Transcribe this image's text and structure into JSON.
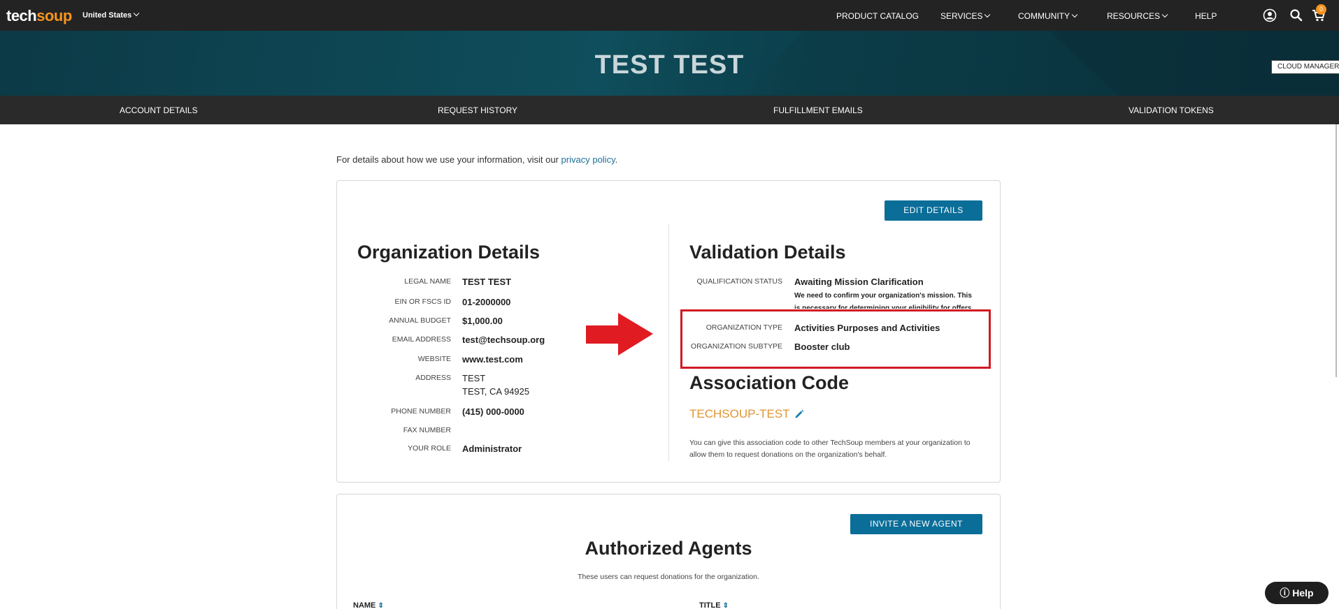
{
  "header": {
    "logo_part1": "tech",
    "logo_part2": "soup",
    "country": "United States",
    "nav": [
      "PRODUCT CATALOG",
      "SERVICES",
      "COMMUNITY",
      "RESOURCES",
      "HELP"
    ],
    "cart_count": "0",
    "icons": [
      "user-icon",
      "search-icon",
      "cart-icon"
    ]
  },
  "hero": {
    "title": "TEST TEST",
    "cloud_manager": "CLOUD MANAGER"
  },
  "subnav": [
    "ACCOUNT DETAILS",
    "REQUEST HISTORY",
    "FULFILLMENT EMAILS",
    "VALIDATION TOKENS"
  ],
  "privacy": {
    "text": "For details about how we use your information, visit our ",
    "link": "privacy policy",
    "end": "."
  },
  "org": {
    "edit_button": "EDIT DETAILS",
    "title": "Organization Details",
    "fields": [
      {
        "label": "LEGAL NAME",
        "value": "TEST TEST"
      },
      {
        "label": "EIN OR FSCS ID",
        "value": "01-2000000"
      },
      {
        "label": "ANNUAL BUDGET",
        "value": "$1,000.00"
      },
      {
        "label": "EMAIL ADDRESS",
        "value": "test@techsoup.org"
      },
      {
        "label": "WEBSITE",
        "value": "www.test.com"
      },
      {
        "label": "ADDRESS",
        "value": "TEST",
        "value2": "TEST, CA 94925"
      },
      {
        "label": "PHONE NUMBER",
        "value": "(415) 000-0000"
      },
      {
        "label": "FAX NUMBER",
        "value": ""
      },
      {
        "label": "YOUR ROLE",
        "value": "Administrator"
      }
    ]
  },
  "validation": {
    "title": "Validation Details",
    "status_label": "QUALIFICATION STATUS",
    "status_value": "Awaiting Mission Clarification",
    "status_note1": "We need to confirm your organization's mission. This",
    "status_note2": "is necessary for determining your eligibility for offers.",
    "type_label": "ORGANIZATION TYPE",
    "type_value": "Activities Purposes and Activities",
    "subtype_label": "ORGANIZATION SUBTYPE",
    "subtype_value": "Booster club"
  },
  "association": {
    "title": "Association Code",
    "code": "TECHSOUP-TEST",
    "desc1": "You can give this association code to other TechSoup members at your organization to",
    "desc2": "allow them to request donations on the organization's behalf."
  },
  "agents": {
    "invite_button": "INVITE A NEW AGENT",
    "title": "Authorized Agents",
    "subtitle": "These users can request donations for the organization.",
    "columns": [
      "NAME",
      "TITLE"
    ]
  },
  "help_button": "Help",
  "colors": {
    "accent": "#0b6e99",
    "orange": "#f7941d",
    "highlight": "#d11a22"
  }
}
